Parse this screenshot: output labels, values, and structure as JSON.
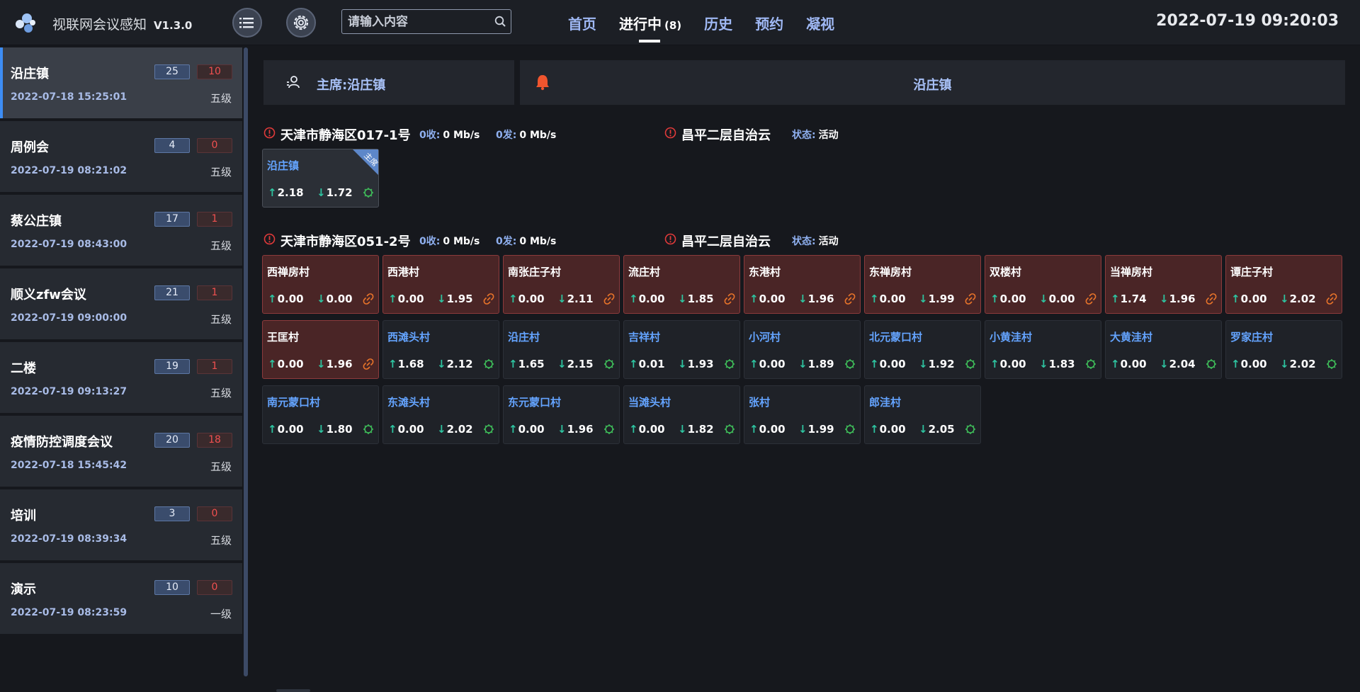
{
  "header": {
    "app_title": "视联网会议感知",
    "version": "V1.3.0",
    "search_placeholder": "请输入内容",
    "datetime": "2022-07-19 09:20:03",
    "tabs": [
      {
        "label": "首页",
        "count": ""
      },
      {
        "label": "进行中",
        "count": "(8)"
      },
      {
        "label": "历史",
        "count": ""
      },
      {
        "label": "预约",
        "count": ""
      },
      {
        "label": "凝视",
        "count": ""
      }
    ],
    "active_tab": 1
  },
  "sidebar": {
    "meetings": [
      {
        "name": "沿庄镇",
        "time": "2022-07-18 15:25:01",
        "level": "五级",
        "count_blue": "25",
        "count_red": "10",
        "active": true
      },
      {
        "name": "周例会",
        "time": "2022-07-19 08:21:02",
        "level": "五级",
        "count_blue": "4",
        "count_red": "0"
      },
      {
        "name": "蔡公庄镇",
        "time": "2022-07-19 08:43:00",
        "level": "五级",
        "count_blue": "17",
        "count_red": "1"
      },
      {
        "name": "顺义zfw会议",
        "time": "2022-07-19 09:00:00",
        "level": "五级",
        "count_blue": "21",
        "count_red": "1"
      },
      {
        "name": "二楼",
        "time": "2022-07-19 09:13:27",
        "level": "五级",
        "count_blue": "19",
        "count_red": "1"
      },
      {
        "name": "疫情防控调度会议",
        "time": "2022-07-18 15:45:42",
        "level": "五级",
        "count_blue": "20",
        "count_red": "18"
      },
      {
        "name": "培训",
        "time": "2022-07-19 08:39:34",
        "level": "五级",
        "count_blue": "3",
        "count_red": "0"
      },
      {
        "name": "演示",
        "time": "2022-07-19 08:23:59",
        "level": "一级",
        "count_blue": "10",
        "count_red": "0"
      }
    ]
  },
  "main": {
    "chair_label": "主席:沿庄镇",
    "speaker_label": "沿庄镇",
    "groups": [
      {
        "title": "天津市静海区017-1号",
        "recv_key": "0收:",
        "recv_val": "0 Mb/s",
        "send_key": "0发:",
        "send_val": "0 Mb/s",
        "cloud": "昌平二层自治云",
        "status_key": "状态:",
        "status_val": "活动"
      },
      {
        "title": "天津市静海区051-2号",
        "recv_key": "0收:",
        "recv_val": "0 Mb/s",
        "send_key": "0发:",
        "send_val": "0 Mb/s",
        "cloud": "昌平二层自治云",
        "status_key": "状态:",
        "status_val": "活动"
      }
    ],
    "chair_tag": "主席",
    "group1_cards": [
      {
        "name": "沿庄镇",
        "up": "2.18",
        "down": "1.72",
        "state": "chair"
      }
    ],
    "group2_cards": [
      {
        "name": "西禅房村",
        "up": "0.00",
        "down": "0.00",
        "state": "alert"
      },
      {
        "name": "西港村",
        "up": "0.00",
        "down": "1.95",
        "state": "alert"
      },
      {
        "name": "南张庄子村",
        "up": "0.00",
        "down": "2.11",
        "state": "alert"
      },
      {
        "name": "流庄村",
        "up": "0.00",
        "down": "1.85",
        "state": "alert"
      },
      {
        "name": "东港村",
        "up": "0.00",
        "down": "1.96",
        "state": "alert"
      },
      {
        "name": "东禅房村",
        "up": "0.00",
        "down": "1.99",
        "state": "alert"
      },
      {
        "name": "双楼村",
        "up": "0.00",
        "down": "0.00",
        "state": "alert"
      },
      {
        "name": "当禅房村",
        "up": "1.74",
        "down": "1.96",
        "state": "alert"
      },
      {
        "name": "谭庄子村",
        "up": "0.00",
        "down": "2.02",
        "state": "alert"
      },
      {
        "name": "王匡村",
        "up": "0.00",
        "down": "1.96",
        "state": "alert"
      },
      {
        "name": "西滩头村",
        "up": "1.68",
        "down": "2.12",
        "state": "ok"
      },
      {
        "name": "沿庄村",
        "up": "1.65",
        "down": "2.15",
        "state": "ok"
      },
      {
        "name": "吉祥村",
        "up": "0.01",
        "down": "1.93",
        "state": "ok"
      },
      {
        "name": "小河村",
        "up": "0.00",
        "down": "1.89",
        "state": "ok"
      },
      {
        "name": "北元蒙口村",
        "up": "0.00",
        "down": "1.92",
        "state": "ok"
      },
      {
        "name": "小黄洼村",
        "up": "0.00",
        "down": "1.83",
        "state": "ok"
      },
      {
        "name": "大黄洼村",
        "up": "0.00",
        "down": "2.04",
        "state": "ok"
      },
      {
        "name": "罗家庄村",
        "up": "0.00",
        "down": "2.02",
        "state": "ok"
      },
      {
        "name": "南元蒙口村",
        "up": "0.00",
        "down": "1.80",
        "state": "ok"
      },
      {
        "name": "东滩头村",
        "up": "0.00",
        "down": "2.02",
        "state": "ok"
      },
      {
        "name": "东元蒙口村",
        "up": "0.00",
        "down": "1.96",
        "state": "ok"
      },
      {
        "name": "当滩头村",
        "up": "0.00",
        "down": "1.82",
        "state": "ok"
      },
      {
        "name": "张村",
        "up": "0.00",
        "down": "1.99",
        "state": "ok"
      },
      {
        "name": "郎洼村",
        "up": "0.00",
        "down": "2.05",
        "state": "ok"
      }
    ]
  }
}
